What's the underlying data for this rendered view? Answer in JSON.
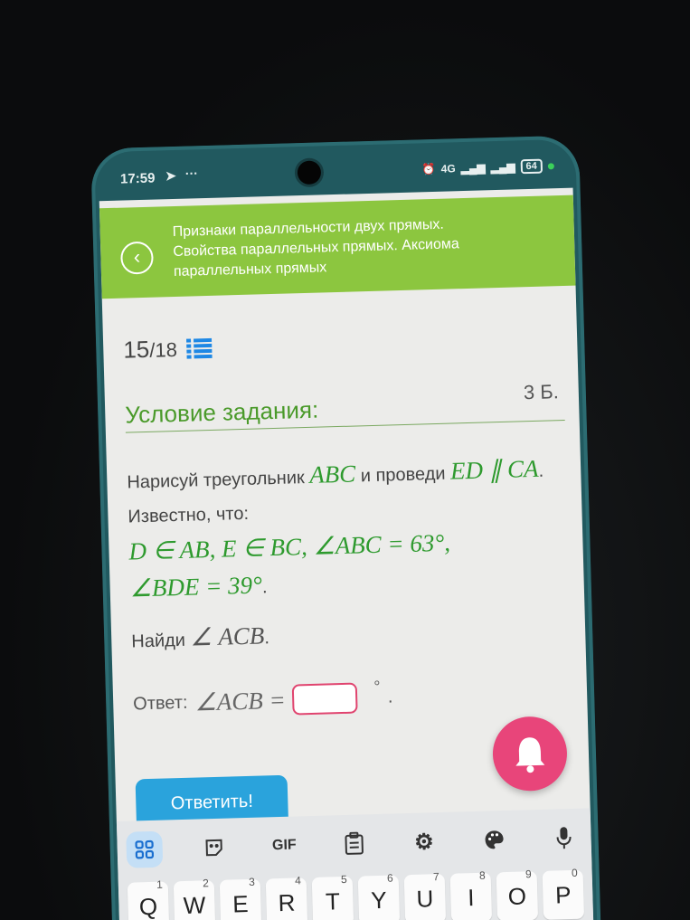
{
  "status_bar": {
    "time": "17:59",
    "battery": "64",
    "network": "4G"
  },
  "header": {
    "back_icon": "chevron-left-icon",
    "title": "Признаки параллельности двух прямых. Свойства параллельных прямых. Аксиома параллельных прямых"
  },
  "progress": {
    "current": "15",
    "total": "/18",
    "list_icon": "list-icon"
  },
  "condition": {
    "label": "Условие задания:",
    "points": "3 Б."
  },
  "task": {
    "intro": "Нарисуй треугольник ",
    "triangle": "ABC",
    "and_draw": " и проведи ",
    "parallel": "ED ∥ CA",
    "known": ". Известно, что:",
    "facts": "D ∈ AB, E ∈ BC, ∠ABC = 63°,",
    "facts2": "∠BDE = 39°",
    "period": "."
  },
  "find": {
    "label": "Найди ",
    "angle": "∠ ACB",
    "period": "."
  },
  "answer": {
    "label": "Ответ: ",
    "angle": "∠ACB =",
    "value": "",
    "degree": "°",
    "dot": "."
  },
  "submit_label": "Ответить!",
  "bell_icon": "bell-icon",
  "keyboard": {
    "tools": [
      "apps-icon",
      "sticker-icon",
      "GIF",
      "clipboard-icon",
      "gear-icon",
      "palette-icon",
      "microphone-icon"
    ],
    "row1": [
      {
        "letter": "Q",
        "num": "1"
      },
      {
        "letter": "W",
        "num": "2"
      },
      {
        "letter": "E",
        "num": "3"
      },
      {
        "letter": "R",
        "num": "4"
      },
      {
        "letter": "T",
        "num": "5"
      },
      {
        "letter": "Y",
        "num": "6"
      },
      {
        "letter": "U",
        "num": "7"
      },
      {
        "letter": "I",
        "num": "8"
      },
      {
        "letter": "O",
        "num": "9"
      },
      {
        "letter": "P",
        "num": "0"
      }
    ]
  },
  "colors": {
    "header_green": "#8cc63f",
    "accent_blue": "#2aa3dc",
    "bell_pink": "#e8457a",
    "math_green": "#2e9a2e"
  }
}
